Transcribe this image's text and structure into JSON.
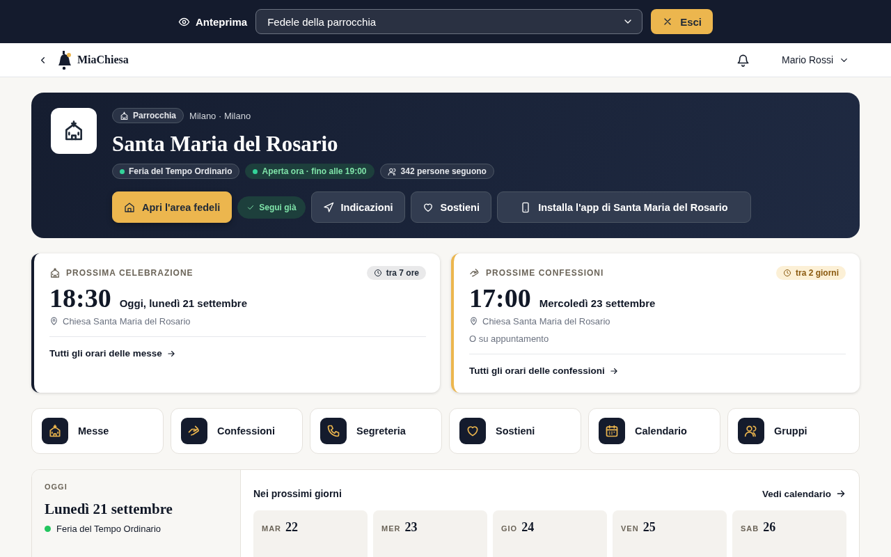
{
  "preview_bar": {
    "label": "Anteprima",
    "role_select": {
      "value": "Fedele della parrocchia"
    },
    "exit_button": "Esci"
  },
  "header": {
    "app_name": "MiaChiesa",
    "user_name": "Mario Rossi"
  },
  "hero": {
    "badge": "Parrocchia",
    "location": "Milano · Milano",
    "title": "Santa Maria del Rosario",
    "tags": [
      {
        "label": "Feria del Tempo Ordinario",
        "kind": "liturgy"
      },
      {
        "label": "Aperta ora · fino alle 19:00",
        "kind": "open"
      },
      {
        "label": "342 persone seguono",
        "kind": "followers"
      }
    ],
    "actions": [
      {
        "label": "Apri l'area fedeli",
        "kind": "primary"
      },
      {
        "label": "Segui già",
        "kind": "following"
      },
      {
        "label": "Indicazioni",
        "kind": "secondary"
      },
      {
        "label": "Sostieni",
        "kind": "secondary"
      },
      {
        "label": "Installa l'app di Santa Maria del Rosario",
        "kind": "secondary"
      }
    ]
  },
  "next_cards": [
    {
      "kind": "mass",
      "heading": "PROSSIMA CELEBRAZIONE",
      "countdown": "tra 7 ore",
      "time": "18:30",
      "date": "Oggi, lunedì 21 settembre",
      "place": "Chiesa Santa Maria del Rosario",
      "link": "Tutti gli orari delle messe"
    },
    {
      "kind": "confession",
      "heading": "PROSSIME CONFESSIONI",
      "countdown": "tra 2 giorni",
      "time": "17:00",
      "date": "Mercoledì 23 settembre",
      "place": "Chiesa Santa Maria del Rosario",
      "note": "O su appuntamento",
      "link": "Tutti gli orari delle confessioni"
    }
  ],
  "shortcuts": [
    {
      "label": "Messe"
    },
    {
      "label": "Confessioni"
    },
    {
      "label": "Segreteria"
    },
    {
      "label": "Sostieni"
    },
    {
      "label": "Calendario"
    },
    {
      "label": "Gruppi"
    }
  ],
  "today": {
    "heading": "OGGI",
    "date": "Lunedì 21 settembre",
    "liturgy": "Feria del Tempo Ordinario"
  },
  "upcoming": {
    "title": "Nei prossimi giorni",
    "link": "Vedi calendario",
    "days": [
      {
        "weekday": "MAR",
        "day": "22"
      },
      {
        "weekday": "MER",
        "day": "23"
      },
      {
        "weekday": "GIO",
        "day": "24"
      },
      {
        "weekday": "VEN",
        "day": "25"
      },
      {
        "weekday": "SAB",
        "day": "26"
      }
    ]
  }
}
